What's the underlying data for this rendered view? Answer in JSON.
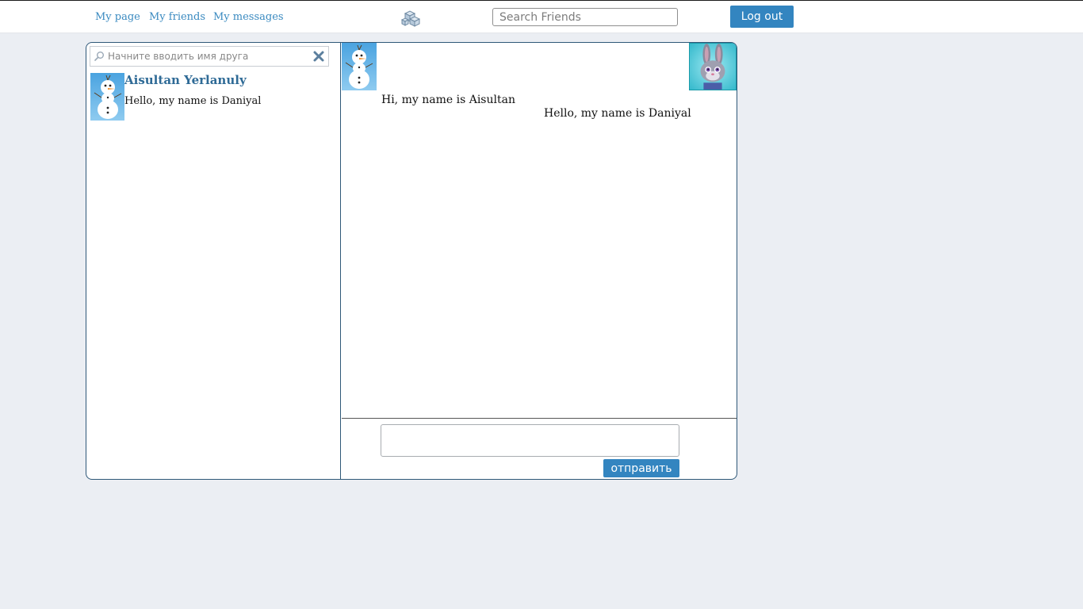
{
  "nav": {
    "my_page": "My page",
    "my_friends": "My friends",
    "my_messages": "My messages",
    "logo_icon": "cubes-logo-icon"
  },
  "search": {
    "placeholder": "Search Friends"
  },
  "header": {
    "logout_label": "Log out"
  },
  "sidebar": {
    "search_placeholder": "Начните вводить имя друга",
    "search_icon": "magnifier-icon",
    "clear_icon": "close-x-icon",
    "dialogs": [
      {
        "name": "Aisultan Yerlanuly",
        "preview": "Hello, my name is Daniyal",
        "avatar_icon": "snowman-avatar"
      }
    ]
  },
  "chat": {
    "left_avatar_icon": "snowman-avatar",
    "right_avatar_icon": "bunny-avatar",
    "messages": [
      {
        "text": "Hi, my name is Aisultan",
        "side": "left"
      },
      {
        "text": "Hello, my name is Daniyal",
        "side": "right"
      }
    ],
    "input_value": "",
    "send_label": "отправить"
  },
  "colors": {
    "accent": "#3385c0",
    "link": "#3a8ac0",
    "name": "#2e6a96",
    "page_bg": "#ebeef3",
    "border": "#2f5878"
  }
}
